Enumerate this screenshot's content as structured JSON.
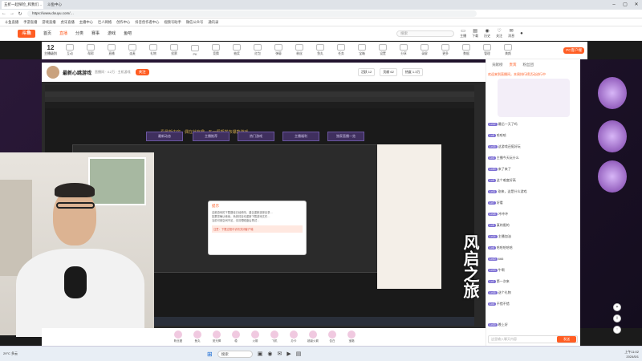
{
  "browser": {
    "tabs": [
      "五折一起探险_和我们…",
      "斗鱼中心"
    ],
    "url": "https://www.douyu.com/…",
    "bookmarks": [
      "斗鱼直播",
      "手游直播",
      "游戏直播",
      "虎牙直播",
      "主播中心",
      "巨人网络",
      "创作中心",
      "抖音创作者中心",
      "视频号助手",
      "微信公众号",
      "通讯录"
    ]
  },
  "site": {
    "logo": "斗鱼",
    "nav": [
      "首页",
      "直播",
      "分类",
      "赛事",
      "游戏",
      "鱼吧"
    ],
    "search_placeholder": "搜索",
    "header_icons": [
      {
        "glyph": "▭",
        "label": "主播"
      },
      {
        "glyph": "▤",
        "label": "下载"
      },
      {
        "glyph": "◉",
        "label": "历史"
      },
      {
        "glyph": "♡",
        "label": "关注"
      },
      {
        "glyph": "✉",
        "label": "消息"
      }
    ]
  },
  "categories": {
    "level": "12",
    "level_label": "主播级别",
    "items": [
      "互动",
      "帮帮",
      "直播",
      "连麦",
      "礼物",
      "投票",
      "PK",
      "竞猜",
      "抽奖",
      "红包",
      "弹幕",
      "粉丝",
      "鱼丸",
      "任务",
      "宝箱",
      "设置",
      "分享",
      "录屏",
      "更多",
      "数据",
      "管理",
      "美颜"
    ],
    "pc_client": "PC客户端"
  },
  "streamer": {
    "title": "最新心跳游戏",
    "sub": "直播间 · 4.2万 · 主机游戏",
    "follow": "关注",
    "stats": [
      "活跃 12",
      "贡献 62",
      "热度 1.3万"
    ]
  },
  "stream": {
    "slogan": "看最新内容，偶在就有趣 · 五一假期发布爆款游戏",
    "buttons": [
      "最新动态",
      "主播推荐",
      "热门游戏",
      "主播福利",
      "独家直播一览"
    ],
    "dialog": {
      "title": "提示",
      "lines": [
        "这款游戏的下载路径已经修改，建议重新选择目录…",
        "如果您确认继续，系统将自动重新下载游戏文件…",
        "当前可用空间不足，请清理磁盘后再试…"
      ],
      "warning": "注意：下载过程中请勿关闭客户端"
    },
    "overlay": "风启之旅"
  },
  "gifts": [
    {
      "label": "粉丝团"
    },
    {
      "label": "鱼丸"
    },
    {
      "label": "荧光棒"
    },
    {
      "label": "稳"
    },
    {
      "label": "火箭"
    },
    {
      "label": "飞机"
    },
    {
      "label": "办卡"
    },
    {
      "label": "超级火箭"
    },
    {
      "label": "告白"
    },
    {
      "label": "宝箱"
    }
  ],
  "chat": {
    "tabs": [
      "贡献榜",
      "贵宾",
      "粉丝团"
    ],
    "notice": "欢迎来到直播间，本周排行榜活动进行中",
    "messages": [
      {
        "badge": "Lv12",
        "text": "最后一天了吗"
      },
      {
        "badge": "Lv8",
        "text": "哈哈哈"
      },
      {
        "badge": "Lv15",
        "text": "这游戏还挺好玩"
      },
      {
        "badge": "Lv3",
        "text": "主播今天玩什么"
      },
      {
        "badge": "Lv20",
        "text": "来了来了"
      },
      {
        "badge": "Lv9",
        "text": "这个难度好高"
      },
      {
        "badge": "Lv11",
        "text": "刚来，这是什么游戏"
      },
      {
        "badge": "Lv7",
        "text": "好看"
      },
      {
        "badge": "Lv18",
        "text": "冲冲冲"
      },
      {
        "badge": "Lv5",
        "text": "真的假的"
      },
      {
        "badge": "Lv14",
        "text": "主播加油"
      },
      {
        "badge": "Lv6",
        "text": "哈哈哈哈哈"
      },
      {
        "badge": "Lv10",
        "text": "666"
      },
      {
        "badge": "Lv13",
        "text": "牛啊"
      },
      {
        "badge": "Lv2",
        "text": "第一次来"
      },
      {
        "badge": "Lv16",
        "text": "送个礼物"
      },
      {
        "badge": "Lv4",
        "text": "不错不错"
      },
      {
        "badge": "Lv19",
        "text": "晚上好"
      }
    ],
    "input_placeholder": "这里输入聊天内容",
    "send": "发送"
  },
  "taskbar": {
    "weather": "29°C 多云",
    "search": "搜索",
    "time": "上午11:02",
    "date": "2024/5/1"
  }
}
